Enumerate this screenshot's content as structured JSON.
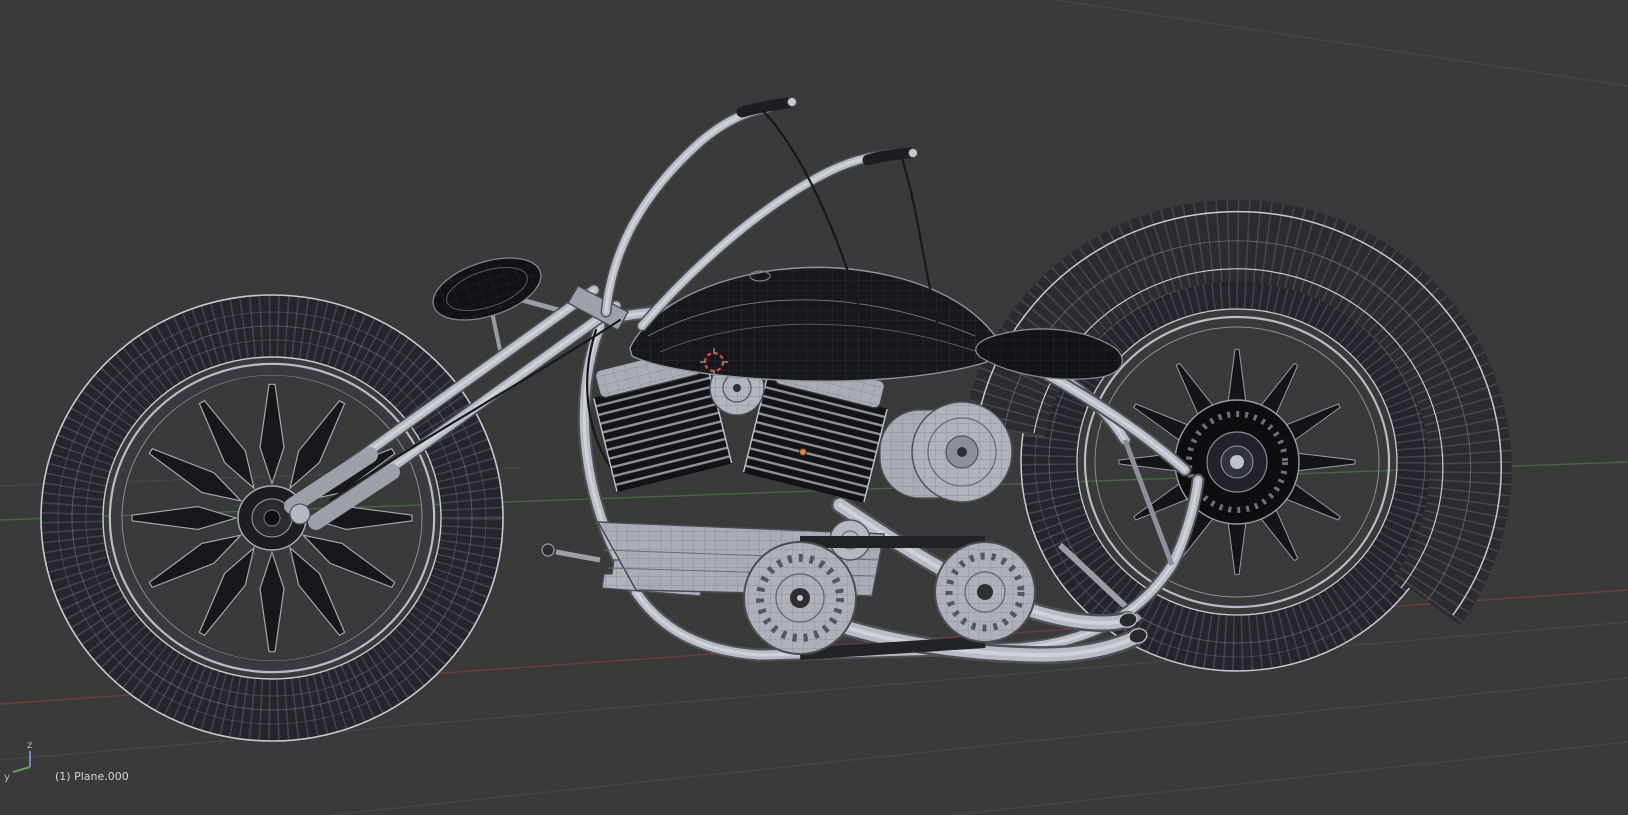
{
  "app": {
    "name": "3d-viewport",
    "view": "wireframe-perspective"
  },
  "scene": {
    "object_label": "(1) Plane.000",
    "gizmo": {
      "z": "z",
      "y": "y"
    },
    "colors": {
      "background": "#3a3a3a",
      "grid_line": "#464646",
      "axis_x": "#6e3d3d",
      "axis_y": "#45683f",
      "wireframe": "#c6c8d2",
      "dark_surface": "#18181c",
      "metal_surface": "#b0b3bc",
      "cursor_red": "#cc4b42",
      "origin_orange": "#e0813a"
    }
  }
}
